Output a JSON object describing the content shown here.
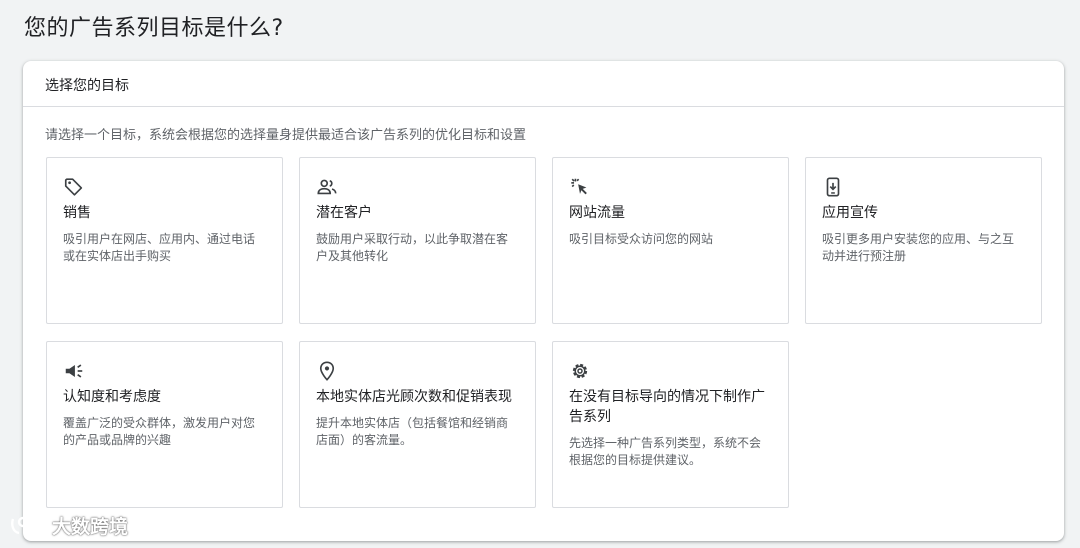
{
  "page_title": "您的广告系列目标是什么?",
  "panel": {
    "header": "选择您的目标",
    "description": "请选择一个目标，系统会根据您的选择量身提供最适合该广告系列的优化目标和设置"
  },
  "goals": [
    {
      "icon": "tag-icon",
      "title": "销售",
      "desc": "吸引用户在网店、应用内、通过电话或在实体店出手购买"
    },
    {
      "icon": "people-icon",
      "title": "潜在客户",
      "desc": "鼓励用户采取行动，以此争取潜在客户及其他转化"
    },
    {
      "icon": "cursor-click-icon",
      "title": "网站流量",
      "desc": "吸引目标受众访问您的网站"
    },
    {
      "icon": "mobile-download-icon",
      "title": "应用宣传",
      "desc": "吸引更多用户安装您的应用、与之互动并进行预注册"
    },
    {
      "icon": "megaphone-icon",
      "title": "认知度和考虑度",
      "desc": "覆盖广泛的受众群体，激发用户对您的产品或品牌的兴趣"
    },
    {
      "icon": "location-pin-icon",
      "title": "本地实体店光顾次数和促销表现",
      "desc": "提升本地实体店（包括餐馆和经销商店面）的客流量。"
    },
    {
      "icon": "gear-icon",
      "title": "在没有目标导向的情况下制作广告系列",
      "desc": "先选择一种广告系列类型，系统不会根据您的目标提供建议。"
    }
  ],
  "watermark": "大数跨境",
  "colors": {
    "background": "#f1f3f4",
    "card_border": "#dadce0",
    "text_primary": "#202124",
    "text_secondary": "#5f6368"
  }
}
